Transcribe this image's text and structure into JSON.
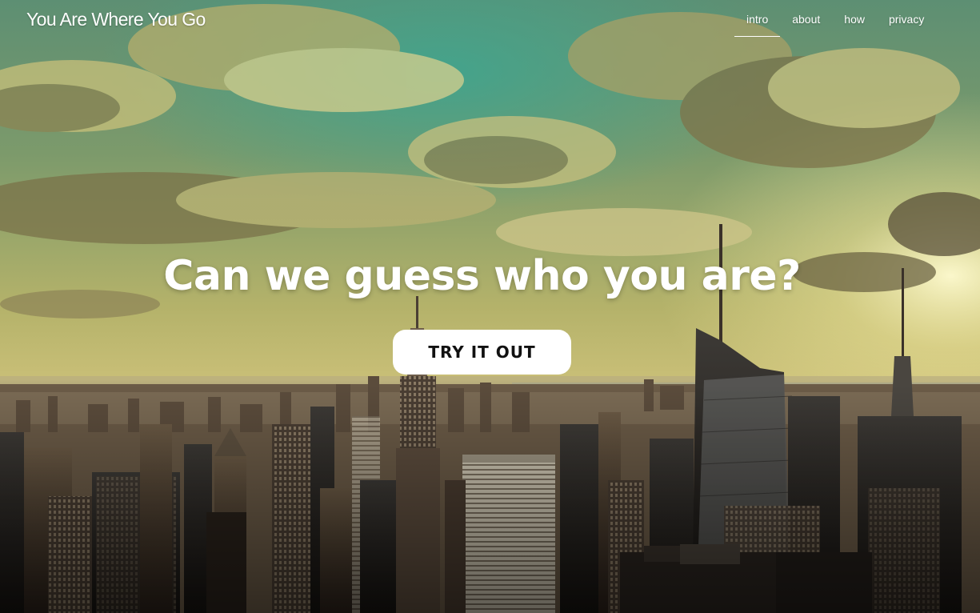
{
  "header": {
    "brand": "You Are Where You Go"
  },
  "nav": {
    "items": [
      {
        "label": "intro",
        "active": true
      },
      {
        "label": "about",
        "active": false
      },
      {
        "label": "how",
        "active": false
      },
      {
        "label": "privacy",
        "active": false
      }
    ]
  },
  "hero": {
    "title": "Can we guess who you are?",
    "cta_label": "TRY IT OUT",
    "background": "city-skyline-photo"
  },
  "colors": {
    "text": "#ffffff",
    "button_bg": "#ffffff",
    "button_text": "#111111",
    "sky_teal": "#3f8f7e",
    "sky_gold": "#c8bf63"
  }
}
